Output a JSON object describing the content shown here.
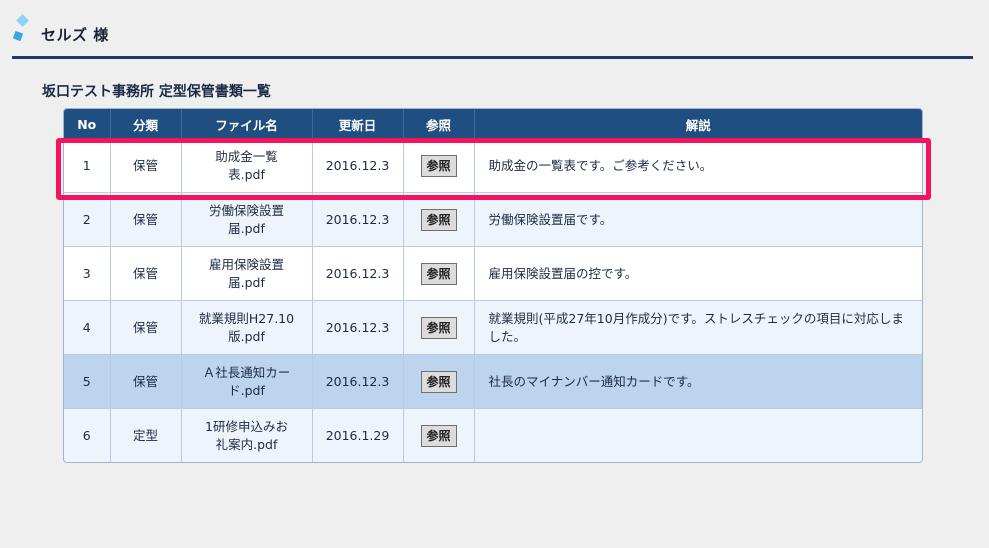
{
  "header": {
    "title": "セルズ 様"
  },
  "section": {
    "title": "坂口テスト事務所 定型保管書類一覧"
  },
  "table": {
    "columns": [
      "No",
      "分類",
      "ファイル名",
      "更新日",
      "参照",
      "解説"
    ],
    "rows": [
      {
        "no": "1",
        "category": "保管",
        "file_line1": "助成金一覧",
        "file_line2": "表.pdf",
        "date": "2016.12.3",
        "ref": "参照",
        "desc": "助成金の一覧表です。ご参考ください。"
      },
      {
        "no": "2",
        "category": "保管",
        "file_line1": "労働保険設置",
        "file_line2": "届.pdf",
        "date": "2016.12.3",
        "ref": "参照",
        "desc": "労働保険設置届です。"
      },
      {
        "no": "3",
        "category": "保管",
        "file_line1": "雇用保険設置",
        "file_line2": "届.pdf",
        "date": "2016.12.3",
        "ref": "参照",
        "desc": "雇用保険設置届の控です。"
      },
      {
        "no": "4",
        "category": "保管",
        "file_line1": "就業規則H27.10",
        "file_line2": "版.pdf",
        "date": "2016.12.3",
        "ref": "参照",
        "desc": "就業規則(平成27年10月作成分)です。ストレスチェックの項目に対応しました。"
      },
      {
        "no": "5",
        "category": "保管",
        "file_line1": "Ａ社長通知カー",
        "file_line2": "ド.pdf",
        "date": "2016.12.3",
        "ref": "参照",
        "desc": "社長のマイナンバー通知カードです。"
      },
      {
        "no": "6",
        "category": "定型",
        "file_line1": "1研修申込みお",
        "file_line2": "礼案内.pdf",
        "date": "2016.1.29",
        "ref": "参照",
        "desc": ""
      }
    ]
  },
  "colors": {
    "header_bg": "#1f4f80",
    "selected_row": "#bcd4ee",
    "highlight_border": "#f5135e",
    "header_rule": "#1f3a68"
  }
}
